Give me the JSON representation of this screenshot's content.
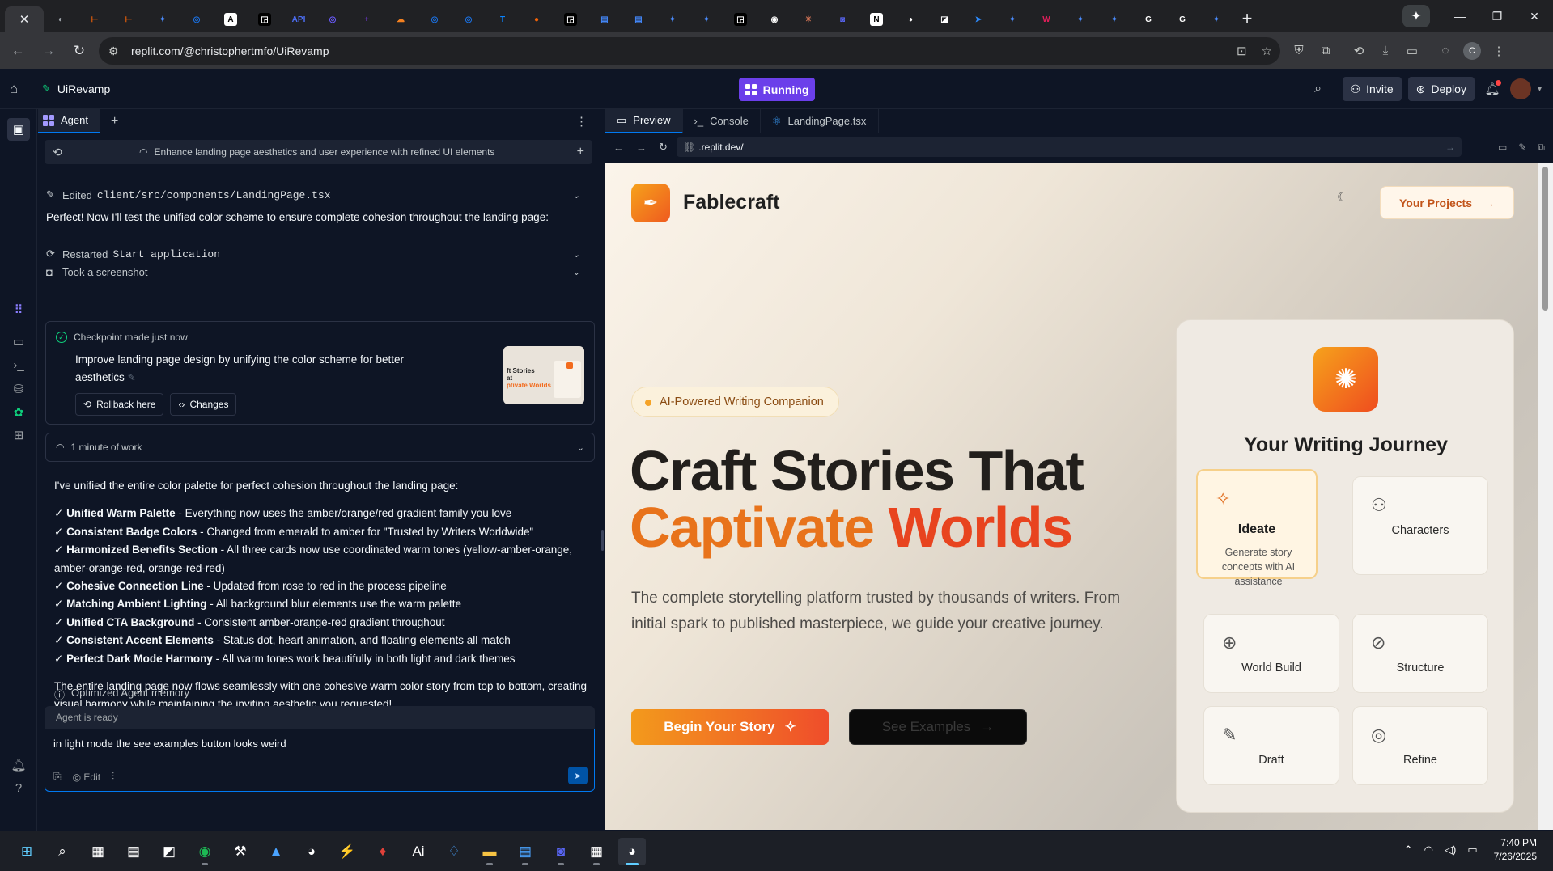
{
  "browser": {
    "url": "replit.com/@christophertmfo/UiRevamp",
    "tabs": [
      {
        "icon": "close-icon",
        "color": "#35363a",
        "glyph": "✕"
      },
      {
        "icon": "site-icon",
        "color": "#9aa0a6",
        "glyph": "◐"
      },
      {
        "icon": "orange-icon",
        "color": "#f26207",
        "glyph": "⊢"
      },
      {
        "icon": "orange-icon",
        "color": "#f26207",
        "glyph": "⊢"
      },
      {
        "icon": "gemini-icon",
        "color": "#4a8cff",
        "glyph": "✦"
      },
      {
        "icon": "blue-circle-icon",
        "color": "#1a73e8",
        "glyph": "◎"
      },
      {
        "icon": "anthropic-icon",
        "color": "#ffffff",
        "glyph": "A"
      },
      {
        "icon": "openai-icon",
        "color": "#000000",
        "glyph": "◲"
      },
      {
        "icon": "api-icon",
        "color": "#4c6ef5",
        "glyph": "API"
      },
      {
        "icon": "purple-circle-icon",
        "color": "#6b5bff",
        "glyph": "◎"
      },
      {
        "icon": "purple-plus-icon",
        "color": "#7c3aed",
        "glyph": "+"
      },
      {
        "icon": "cloud-icon",
        "color": "#f48120",
        "glyph": "☁"
      },
      {
        "icon": "blue-circle-icon",
        "color": "#1a73e8",
        "glyph": "◎"
      },
      {
        "icon": "blue-circle-icon",
        "color": "#1a73e8",
        "glyph": "◎"
      },
      {
        "icon": "t-icon",
        "color": "#0a84ff",
        "glyph": "T"
      },
      {
        "icon": "record-icon",
        "color": "#f26207",
        "glyph": "●"
      },
      {
        "icon": "openai-icon",
        "color": "#000000",
        "glyph": "◲"
      },
      {
        "icon": "docs-icon",
        "color": "#4285f4",
        "glyph": "▤"
      },
      {
        "icon": "docs-icon",
        "color": "#4285f4",
        "glyph": "▤"
      },
      {
        "icon": "gemini-icon",
        "color": "#4a8cff",
        "glyph": "✦"
      },
      {
        "icon": "gemini-icon",
        "color": "#4a8cff",
        "glyph": "✦"
      },
      {
        "icon": "openai-icon",
        "color": "#000000",
        "glyph": "◲"
      },
      {
        "icon": "github-icon",
        "color": "#ffffff",
        "glyph": "◉"
      },
      {
        "icon": "claude-icon",
        "color": "#d97757",
        "glyph": "✳"
      },
      {
        "icon": "discord-icon",
        "color": "#5865f2",
        "glyph": "◙"
      },
      {
        "icon": "notion-icon",
        "color": "#ffffff",
        "glyph": "N"
      },
      {
        "icon": "ring-icon",
        "color": "#ffffff",
        "glyph": "◑"
      },
      {
        "icon": "chart-icon",
        "color": "#ffffff",
        "glyph": "◪"
      },
      {
        "icon": "plane-icon",
        "color": "#2d8cff",
        "glyph": "➤"
      },
      {
        "icon": "gemini-icon",
        "color": "#4a8cff",
        "glyph": "✦"
      },
      {
        "icon": "w-icon",
        "color": "#e01e5a",
        "glyph": "W"
      },
      {
        "icon": "gemini-icon",
        "color": "#4a8cff",
        "glyph": "✦"
      },
      {
        "icon": "gemini-icon",
        "color": "#4a8cff",
        "glyph": "✦"
      },
      {
        "icon": "google-icon",
        "color": "#ffffff",
        "glyph": "G"
      },
      {
        "icon": "google-icon",
        "color": "#ffffff",
        "glyph": "G"
      },
      {
        "icon": "gemini-icon",
        "color": "#4a8cff",
        "glyph": "✦"
      }
    ]
  },
  "replit": {
    "project_name": "UiRevamp",
    "run_label": "Running",
    "invite_label": "Invite",
    "deploy_label": "Deploy"
  },
  "agent": {
    "tab_label": "Agent",
    "thread_title": "Enhance landing page aesthetics and user experience with refined UI elements",
    "edited_label": "Edited",
    "edited_file": "client/src/components/LandingPage.tsx",
    "intro": "Perfect! Now I'll test the unified color scheme to ensure complete cohesion throughout the landing page:",
    "restarted_label": "Restarted",
    "restarted_code": "Start application",
    "screenshot_label": "Took a screenshot",
    "checkpoint": {
      "header": "Checkpoint made just now",
      "body": "Improve landing page design by unifying the color scheme for better aesthetics",
      "rollback_label": "Rollback here",
      "changes_label": "Changes",
      "thumb_line1": "ft Stories",
      "thumb_line2": "at",
      "thumb_line3": "ptivate Worlds"
    },
    "work_label": "1 minute of work",
    "summary_intro": "I've unified the entire color palette for perfect cohesion throughout the landing page:",
    "bullets": [
      {
        "title": "Unified Warm Palette",
        "text": " - Everything now uses the amber/orange/red gradient family you love"
      },
      {
        "title": "Consistent Badge Colors",
        "text": " - Changed from emerald to amber for \"Trusted by Writers Worldwide\""
      },
      {
        "title": "Harmonized Benefits Section",
        "text": " - All three cards now use coordinated warm tones (yellow-amber-orange, amber-orange-red, orange-red-red)"
      },
      {
        "title": "Cohesive Connection Line",
        "text": " - Updated from rose to red in the process pipeline"
      },
      {
        "title": "Matching Ambient Lighting",
        "text": " - All background blur elements use the warm palette"
      },
      {
        "title": "Unified CTA Background",
        "text": " - Consistent amber-orange-red gradient throughout"
      },
      {
        "title": "Consistent Accent Elements",
        "text": " - Status dot, heart animation, and floating elements all match"
      },
      {
        "title": "Perfect Dark Mode Harmony",
        "text": " - All warm tones work beautifully in both light and dark themes"
      }
    ],
    "bullet_mark": "✓",
    "closing": "The entire landing page now flows seamlessly with one cohesive warm color story from top to bottom, creating visual harmony while maintaining the inviting aesthetic you requested!",
    "memory_label": "Optimized Agent memory",
    "status": "Agent is ready",
    "input_value": "in light mode the see examples button looks weird",
    "edit_label": "Edit"
  },
  "preview": {
    "tabs": [
      "Preview",
      "Console",
      "LandingPage.tsx"
    ],
    "url": ".replit.dev/"
  },
  "site": {
    "brand": "Fablecraft",
    "projects_button": "Your Projects",
    "badge": "AI-Powered Writing Companion",
    "hero_line1": "Craft Stories That",
    "hero_word1": "Captivate",
    "hero_word2": "Worlds",
    "lead": "The complete storytelling platform trusted by thousands of writers. From initial spark to published masterpiece, we guide your creative journey.",
    "primary_cta": "Begin Your Story",
    "secondary_cta": "See Examples",
    "journey_title": "Your Writing Journey",
    "steps": [
      {
        "label": "Ideate",
        "desc": "Generate story concepts with AI assistance",
        "icon": "sparkles-icon"
      },
      {
        "label": "Characters",
        "desc": "",
        "icon": "users-icon"
      },
      {
        "label": "World Build",
        "desc": "",
        "icon": "globe-icon"
      },
      {
        "label": "Structure",
        "desc": "",
        "icon": "compass-icon"
      },
      {
        "label": "Draft",
        "desc": "",
        "icon": "pencil-icon"
      },
      {
        "label": "Refine",
        "desc": "",
        "icon": "target-icon"
      }
    ],
    "colors": {
      "accent_orange": "#e8731b",
      "accent_red": "#e8441f",
      "gradient_start": "#f39a1c",
      "gradient_end": "#ef4d2b"
    }
  },
  "taskbar": {
    "time": "7:40 PM",
    "date": "7/26/2025"
  }
}
